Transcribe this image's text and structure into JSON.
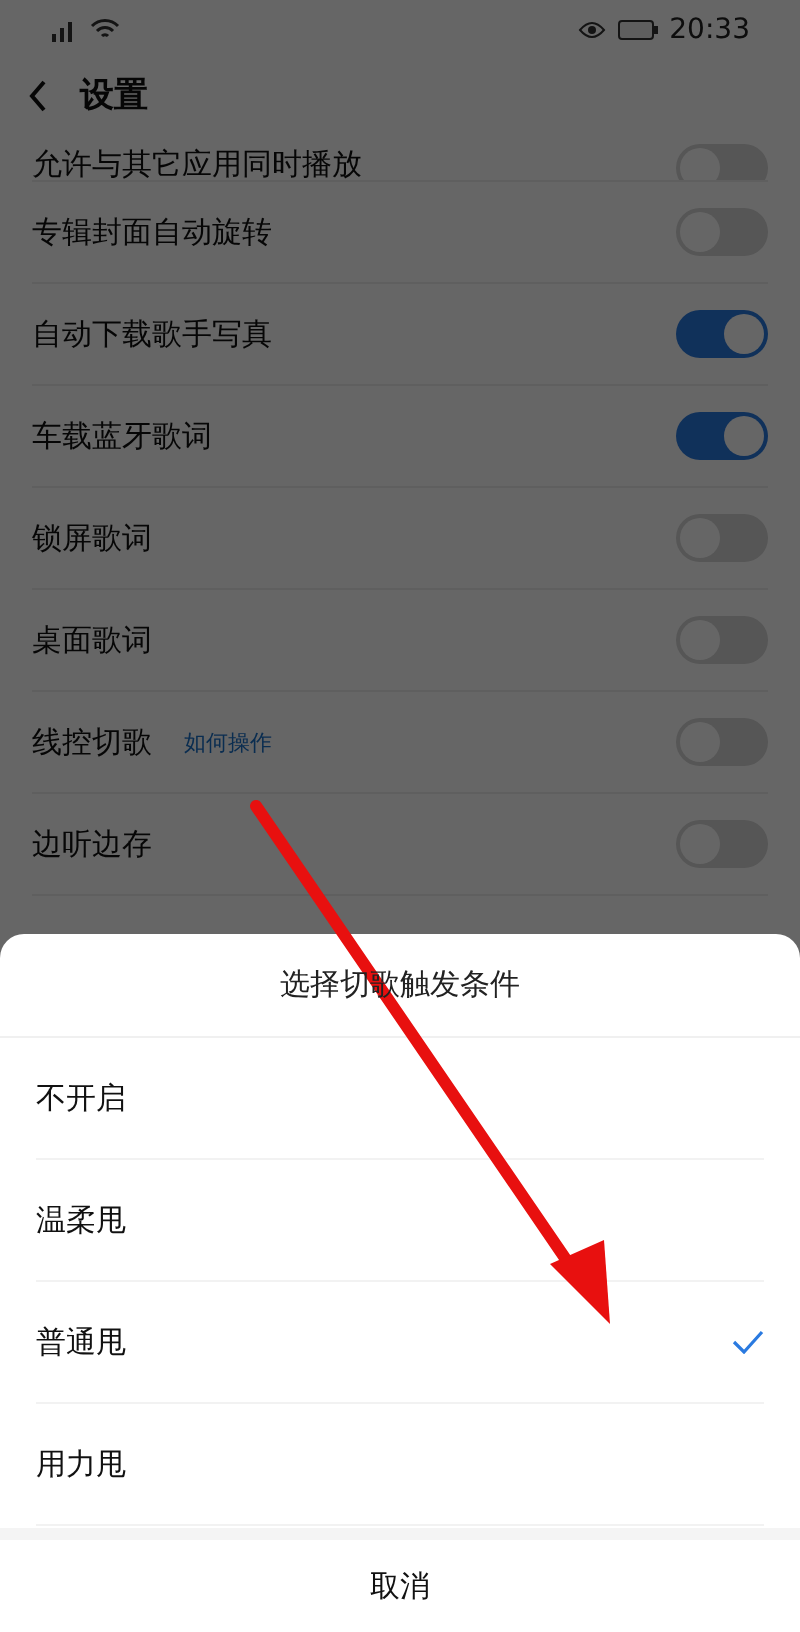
{
  "status_bar": {
    "time": "20:33"
  },
  "header": {
    "title": "设置"
  },
  "settings": [
    {
      "label": "允许与其它应用同时播放",
      "on": false,
      "partial": true
    },
    {
      "label": "专辑封面自动旋转",
      "on": false
    },
    {
      "label": "自动下载歌手写真",
      "on": true
    },
    {
      "label": "车载蓝牙歌词",
      "on": true
    },
    {
      "label": "锁屏歌词",
      "on": false
    },
    {
      "label": "桌面歌词",
      "on": false
    },
    {
      "label": "线控切歌",
      "link": "如何操作",
      "on": false
    },
    {
      "label": "边听边存",
      "on": false
    }
  ],
  "sheet": {
    "title": "选择切歌触发条件",
    "options": [
      {
        "label": "不开启",
        "selected": false
      },
      {
        "label": "温柔甩",
        "selected": false
      },
      {
        "label": "普通甩",
        "selected": true
      },
      {
        "label": "用力甩",
        "selected": false
      }
    ],
    "cancel": "取消"
  }
}
